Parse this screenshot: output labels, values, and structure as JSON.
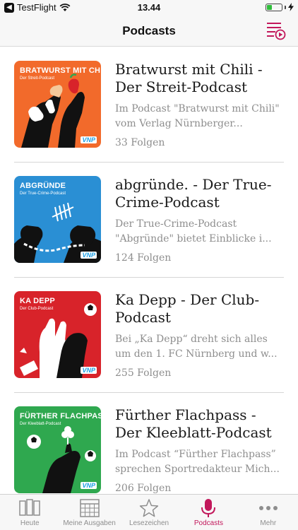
{
  "status": {
    "carrier": "TestFlight",
    "time": "13.44",
    "battery_level": 0.35
  },
  "nav": {
    "title": "Podcasts",
    "right_icon": "playlist-play-icon"
  },
  "colors": {
    "accent": "#c2185b",
    "secondary_text": "#8e8e8e"
  },
  "podcasts": [
    {
      "title": "Bratwurst mit Chili - Der Streit-Podcast",
      "description": "Im Podcast \"Bratwurst mit Chili\" vom Verlag Nürnberger...",
      "count": "33 Folgen",
      "cover_title": "BRATWURST MIT CHILI",
      "cover_subtitle": "Der Streit-Podcast",
      "cover_color": "#f26a2b",
      "cover_logo": "VNP"
    },
    {
      "title": "abgründe. - Der True-Crime-Podcast",
      "description": "Der True-Crime-Podcast \"Abgründe\" bietet Einblicke i...",
      "count": "124 Folgen",
      "cover_title": "ABGRÜNDE",
      "cover_subtitle": "Der True-Crime-Podcast",
      "cover_color": "#2a8fd4",
      "cover_logo": "VNP"
    },
    {
      "title": "Ka Depp - Der Club-Podcast",
      "description": "Bei „Ka Depp“ dreht sich alles um den 1. FC Nürnberg und w...",
      "count": "255 Folgen",
      "cover_title": "KA DEPP",
      "cover_subtitle": "Der Club-Podcast",
      "cover_color": "#d8232a",
      "cover_logo": "VNP"
    },
    {
      "title": "Fürther Flachpass - Der Kleeblatt-Podcast",
      "description": "Im Podcast “Fürther Flachpass” sprechen Sportredakteur Mich...",
      "count": "206 Folgen",
      "cover_title": "FÜRTHER FLACHPASS",
      "cover_subtitle": "Der Kleeblatt-Podcast",
      "cover_color": "#2fa84f",
      "cover_logo": "VNP"
    }
  ],
  "tabs": [
    {
      "label": "Heute",
      "icon": "pages-icon",
      "active": false
    },
    {
      "label": "Meine Ausgaben",
      "icon": "calendar-grid-icon",
      "active": false
    },
    {
      "label": "Lesezeichen",
      "icon": "star-icon",
      "active": false
    },
    {
      "label": "Podcasts",
      "icon": "microphone-icon",
      "active": true
    },
    {
      "label": "Mehr",
      "icon": "more-dots-icon",
      "active": false
    }
  ]
}
